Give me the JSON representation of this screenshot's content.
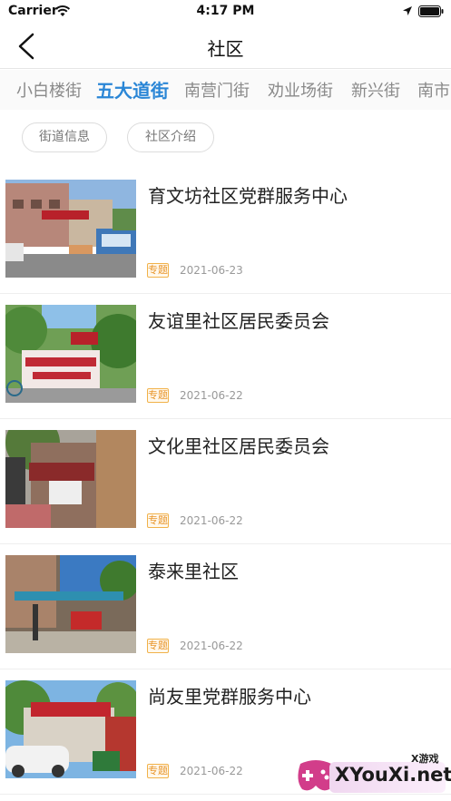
{
  "status": {
    "carrier": "Carrier",
    "time": "4:17 PM"
  },
  "nav": {
    "title": "社区"
  },
  "streets": [
    {
      "label": "小白楼街",
      "active": false
    },
    {
      "label": "五大道街",
      "active": true
    },
    {
      "label": "南营门街",
      "active": false
    },
    {
      "label": "劝业场街",
      "active": false
    },
    {
      "label": "新兴街",
      "active": false
    },
    {
      "label": "南市",
      "active": false
    }
  ],
  "pills": [
    "街道信息",
    "社区介绍"
  ],
  "items": [
    {
      "title": "育文坊社区党群服务中心",
      "tag": "专题",
      "date": "2021-06-23"
    },
    {
      "title": "友谊里社区居民委员会",
      "tag": "专题",
      "date": "2021-06-22"
    },
    {
      "title": "文化里社区居民委员会",
      "tag": "专题",
      "date": "2021-06-22"
    },
    {
      "title": "泰来里社区",
      "tag": "专题",
      "date": "2021-06-22"
    },
    {
      "title": "尚友里党群服务中心",
      "tag": "专题",
      "date": "2021-06-22"
    }
  ],
  "watermark": {
    "top": "X游戏",
    "main": "XYouXi.net"
  },
  "colors": {
    "accent": "#2a86d6",
    "tag": "#e8952a"
  }
}
